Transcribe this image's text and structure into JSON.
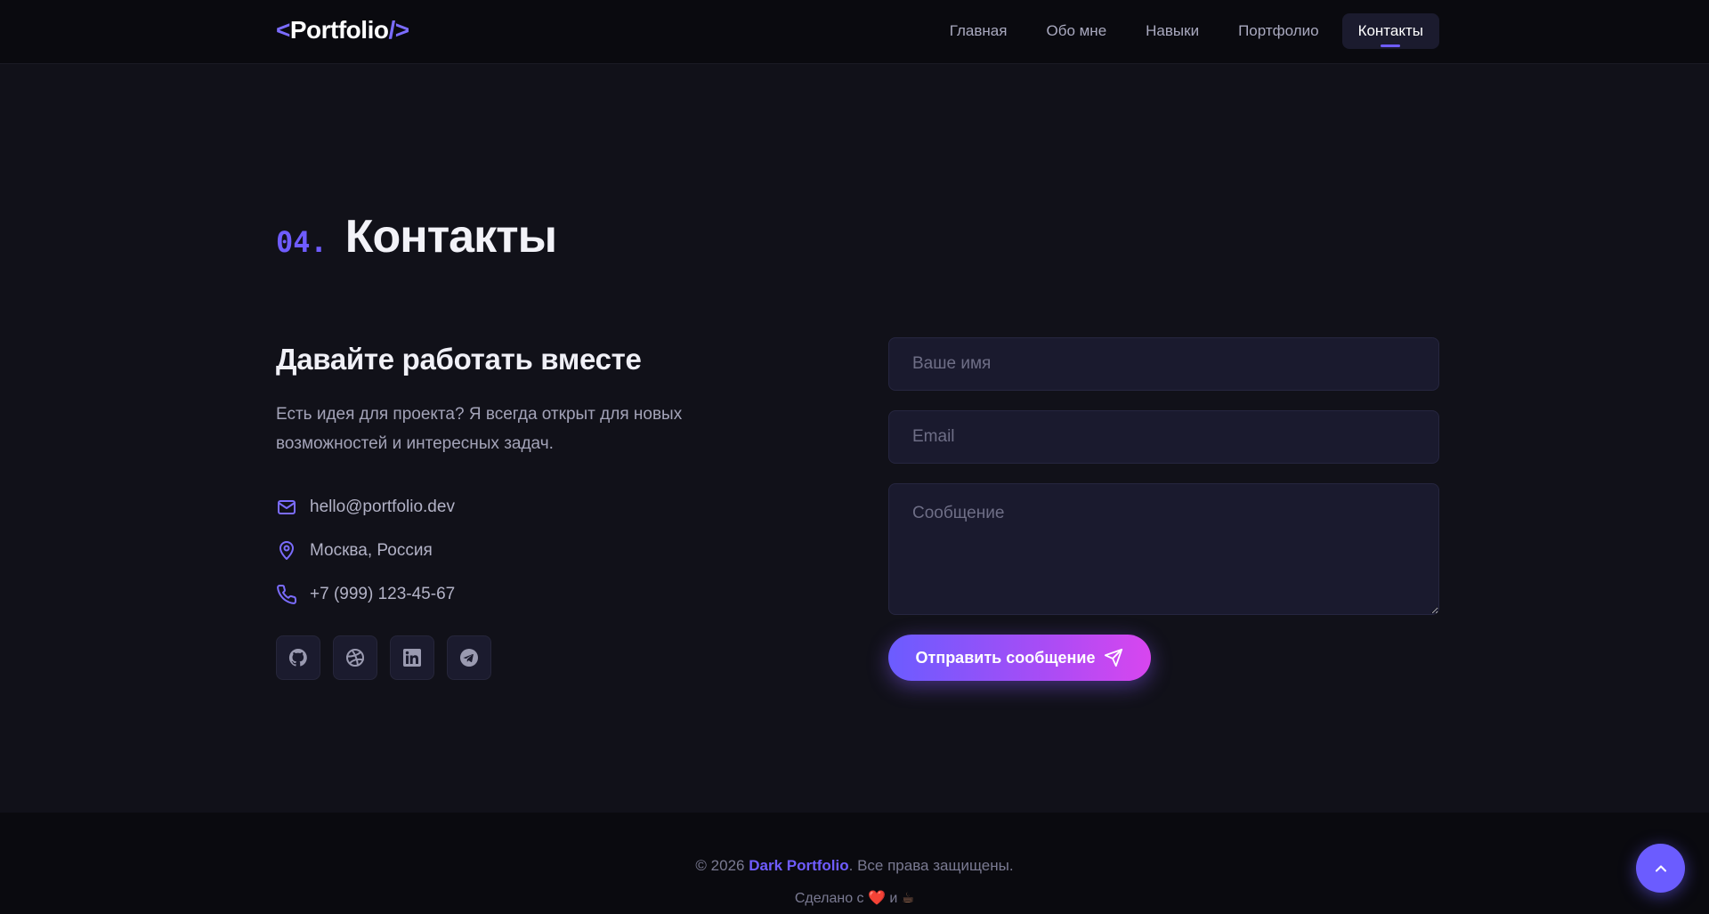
{
  "header": {
    "logo_open": "<",
    "logo_text": "Portfolio",
    "logo_close": "/>",
    "nav": [
      {
        "label": "Главная"
      },
      {
        "label": "Обо мне"
      },
      {
        "label": "Навыки"
      },
      {
        "label": "Портфолио"
      },
      {
        "label": "Контакты",
        "active": true
      }
    ]
  },
  "section": {
    "number": "04.",
    "title": "Контакты"
  },
  "contact": {
    "heading": "Давайте работать вместе",
    "description": "Есть идея для проекта? Я всегда открыт для новых возможностей и интересных задач.",
    "email": "hello@portfolio.dev",
    "location": "Москва, Россия",
    "phone": "+7 (999) 123-45-67",
    "socials": [
      "github-icon",
      "dribbble-icon",
      "linkedin-icon",
      "telegram-icon"
    ]
  },
  "form": {
    "name_placeholder": "Ваше имя",
    "email_placeholder": "Email",
    "message_placeholder": "Сообщение",
    "submit_label": "Отправить сообщение"
  },
  "footer": {
    "copyright_prefix": "© 2026",
    "brand": "Dark Portfolio",
    "copyright_suffix": ". Все права защищены.",
    "made_prefix": "Сделано с",
    "made_and": "и",
    "heart": "❤️",
    "coffee": "☕"
  },
  "colors": {
    "accent": "#6f5cff",
    "background": "#111119",
    "gradient_end": "#d846ef"
  }
}
